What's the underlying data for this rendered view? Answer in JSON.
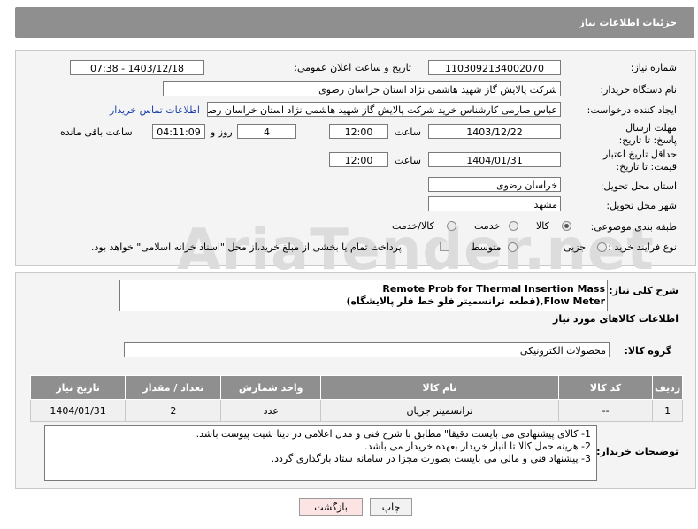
{
  "header": {
    "title": "جزئیات اطلاعات نیاز"
  },
  "watermark": "AriaTender.net",
  "form": {
    "need_number_label": "شماره نیاز:",
    "need_number": "1103092134002070",
    "announce_label": "تاریخ و ساعت اعلان عمومی:",
    "announce_value": "1403/12/18 - 07:38",
    "buyer_label": "نام دستگاه خریدار:",
    "buyer_value": "شرکت پالایش گاز شهید هاشمی نژاد   استان خراسان رضوی",
    "creator_label": "ایجاد کننده درخواست:",
    "creator_value": "عباس صارمی کارشناس خرید  شرکت پالایش گاز شهید هاشمی نژاد   استان خراسان رضوی",
    "contact_link": "اطلاعات تماس خریدار",
    "deadline_label": "مهلت ارسال پاسخ: تا تاریخ:",
    "deadline_date": "1403/12/22",
    "time_label": "ساعت",
    "deadline_time": "12:00",
    "days_value": "4",
    "days_label": "روز و",
    "remaining_time": "04:11:09",
    "remaining_label": "ساعت باقی مانده",
    "validity_label": "حداقل تاریخ اعتبار قیمت: تا تاریخ:",
    "validity_date": "1404/01/31",
    "validity_time": "12:00",
    "province_label": "استان محل تحویل:",
    "province_value": "خراسان رضوی",
    "city_label": "شهر محل تحویل:",
    "city_value": "مشهد",
    "category_label": "طبقه بندی موضوعی:",
    "category_options": [
      "کالا",
      "خدمت",
      "کالا/خدمت"
    ],
    "category_selected": "کالا",
    "process_label": "نوع فرآیند خرید :",
    "process_options": [
      "جزیی",
      "متوسط"
    ],
    "process_note": "پرداخت تمام یا بخشی از مبلغ خرید،از محل \"اسناد خزانه اسلامی\" خواهد بود."
  },
  "description": {
    "label": "شرح کلی نیاز:",
    "line1": "Remote Prob for Thermal Insertion Mass",
    "line2": "Flow Meter,(قطعه ترانسمیتر فلو خط فلر پالایشگاه)"
  },
  "goods_section": {
    "title": "اطلاعات کالاهای مورد نیاز",
    "group_label": "گروه کالا:",
    "group_value": "محصولات الکترونیکی"
  },
  "table": {
    "headers": [
      "ردیف",
      "کد کالا",
      "نام کالا",
      "واحد شمارش",
      "تعداد / مقدار",
      "تاریخ نیاز"
    ],
    "rows": [
      {
        "row": "1",
        "code": "--",
        "name": "ترانسمیتر جریان",
        "unit": "عدد",
        "qty": "2",
        "date": "1404/01/31"
      }
    ]
  },
  "buyer_notes": {
    "label": "توضیحات خریدار:",
    "lines": [
      "1-    کالای پیشنهادی می بایست دقیقا\" مطابق با شرح فنی و مدل اعلامی در دیتا شیت پیوست باشد.",
      "2-    هزینه حمل کالا تا انبار خریدار بعهده خریدار می باشد.",
      "3-    پیشنهاد فنی و مالی می بایست بصورت مجزا در سامانه ستاد بارگذاری گردد."
    ]
  },
  "buttons": {
    "print": "چاپ",
    "back": "بازگشت"
  }
}
